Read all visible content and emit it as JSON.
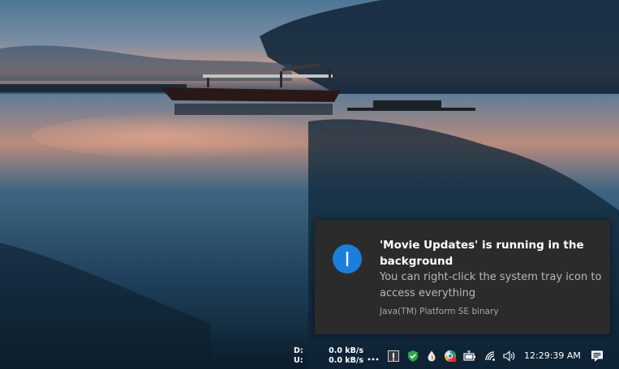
{
  "notification": {
    "title": "'Movie Updates' is running in the background",
    "body": "You can right-click the system tray icon to access everything",
    "source": "Java(TM) Platform SE binary",
    "accent_color": "#1a7fdc"
  },
  "taskbar": {
    "network_speed": {
      "download_label": "D:",
      "upload_label": "U:",
      "download_value": "0.0 kB/s",
      "upload_value": "0.0 kB/s"
    },
    "overflow_label": "•••",
    "clock": "12:29:39 AM"
  }
}
